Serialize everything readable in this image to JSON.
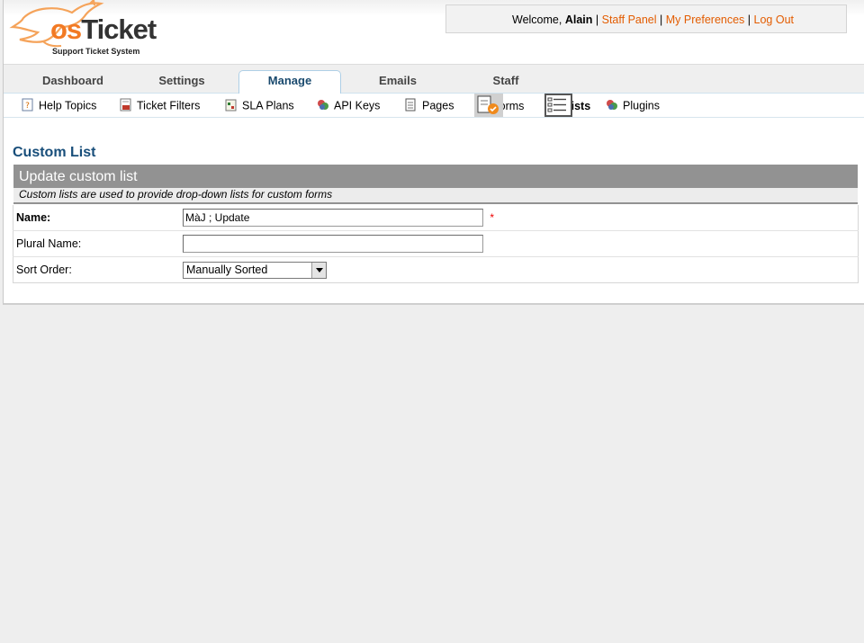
{
  "header": {
    "logo_text_os": "os",
    "logo_text_ticket": "Ticket",
    "logo_subtitle": "Support Ticket System",
    "welcome_label": "Welcome,",
    "user_name": "Alain",
    "staff_panel": "Staff Panel",
    "my_preferences": "My Preferences",
    "log_out": "Log Out",
    "separator": "|"
  },
  "nav": {
    "tabs": [
      {
        "label": "Dashboard",
        "active": false
      },
      {
        "label": "Settings",
        "active": false
      },
      {
        "label": "Manage",
        "active": true
      },
      {
        "label": "Emails",
        "active": false
      },
      {
        "label": "Staff",
        "active": false
      }
    ]
  },
  "subnav": {
    "items": [
      {
        "label": "Help Topics",
        "icon": "help-topics-icon"
      },
      {
        "label": "Ticket Filters",
        "icon": "ticket-filters-icon"
      },
      {
        "label": "SLA Plans",
        "icon": "sla-plans-icon"
      },
      {
        "label": "API Keys",
        "icon": "api-keys-icon"
      },
      {
        "label": "Pages",
        "icon": "pages-icon"
      },
      {
        "label": "Forms",
        "icon": "forms-icon"
      },
      {
        "label": "Lists",
        "icon": "lists-icon",
        "active": true
      },
      {
        "label": "Plugins",
        "icon": "plugins-icon"
      }
    ]
  },
  "main": {
    "page_title": "Custom List",
    "form": {
      "title": "Update custom list",
      "description": "Custom lists are used to provide drop-down lists for custom forms",
      "fields": {
        "name": {
          "label": "Name:",
          "value": "MàJ ; Update",
          "required_mark": "*"
        },
        "plural_name": {
          "label": "Plural Name:",
          "value": ""
        },
        "sort_order": {
          "label": "Sort Order:",
          "value": "Manually Sorted"
        }
      }
    }
  },
  "colors": {
    "accent_link": "#e35c00",
    "title_blue": "#184e7a",
    "form_header": "#929292"
  }
}
